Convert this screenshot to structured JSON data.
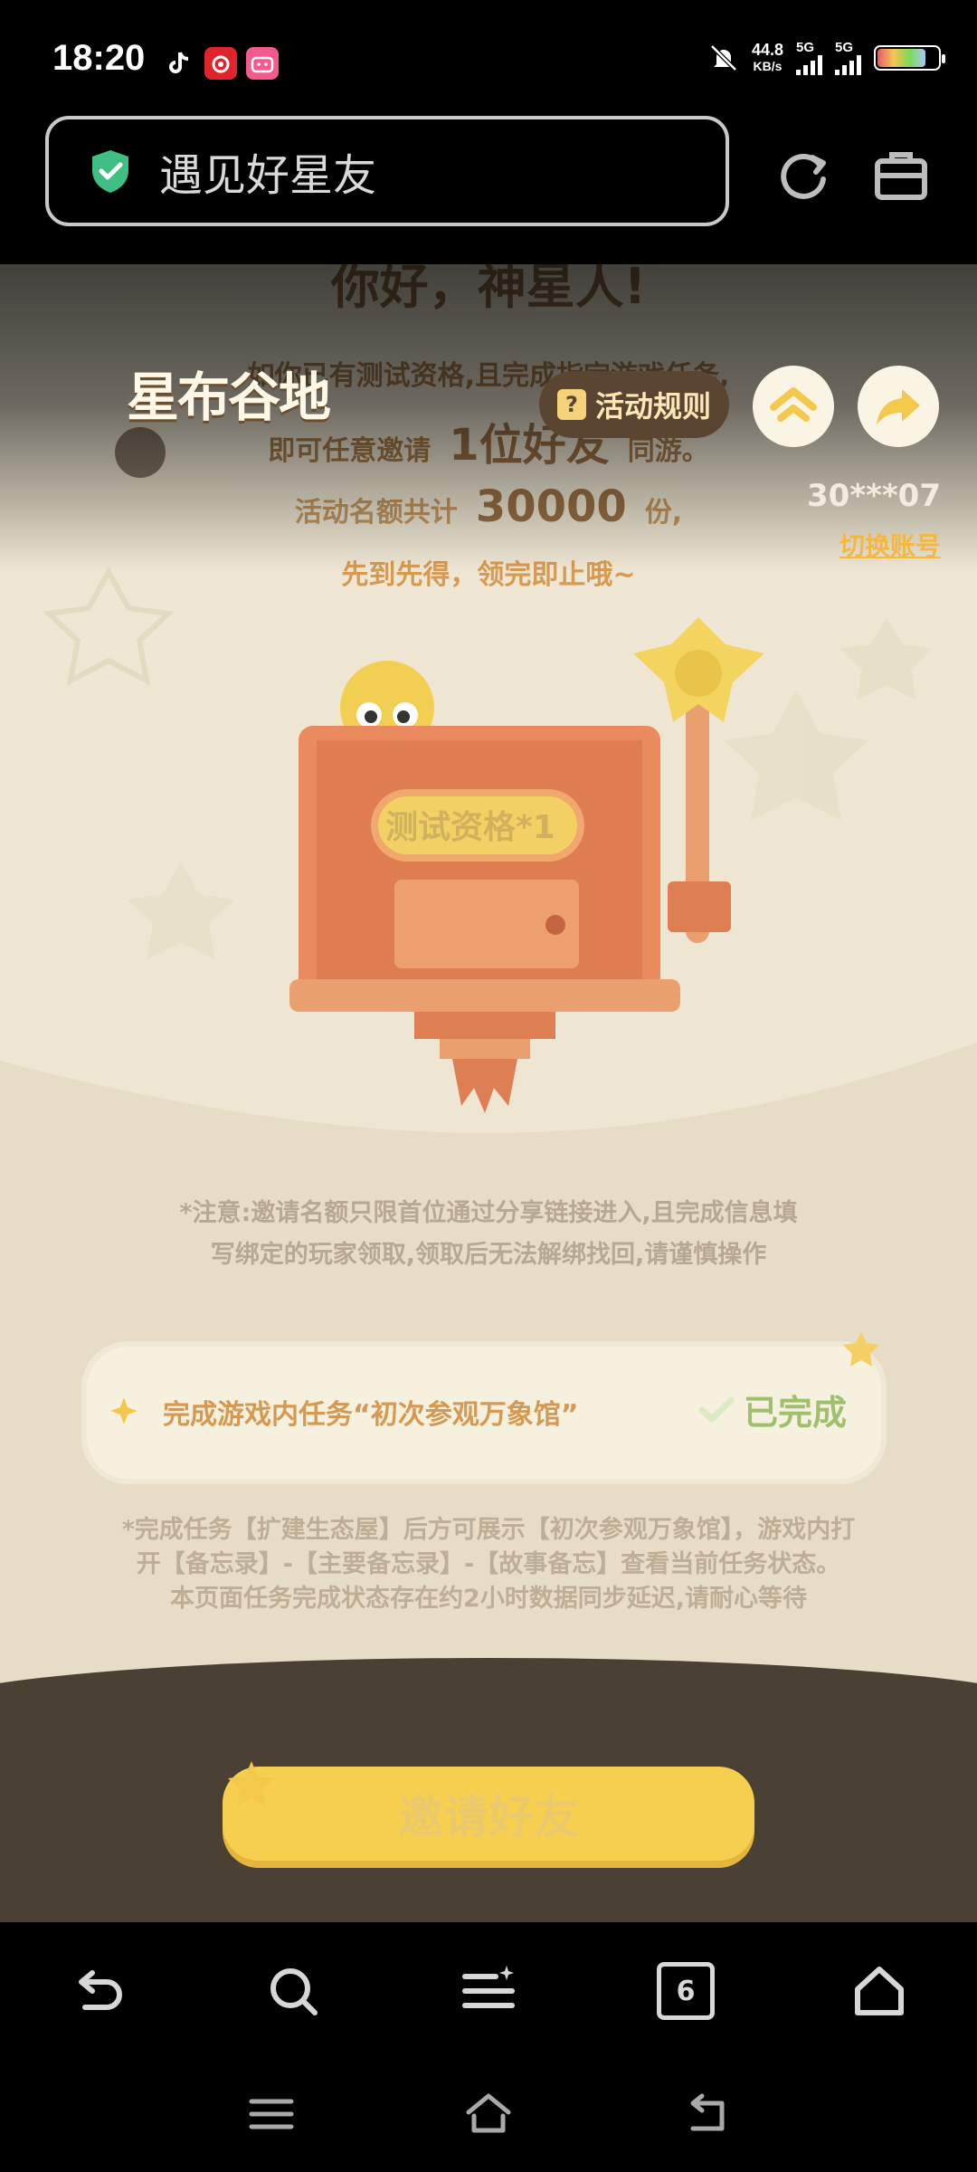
{
  "status_bar": {
    "time": "18:20",
    "net_speed_value": "44.8",
    "net_speed_unit": "KB/s",
    "sim1": "5G",
    "sim2": "5G",
    "battery_level": 0.8
  },
  "browser": {
    "url_title": "遇见好星友",
    "tab_count": "6"
  },
  "header": {
    "logo_text": "星布谷地",
    "rules_label": "活动规则",
    "account_id": "30***07",
    "switch_account": "切换账号"
  },
  "intro": {
    "line1": "你好，神星人!",
    "line2": "如你已有测试资格,且完成指定游戏任务,",
    "line3_prefix": "即可任意邀请",
    "line3_count": "1位好友",
    "line3_suffix": "同游。",
    "line4_prefix": "活动名额共计",
    "line4_count": "30000",
    "line4_suffix": "份,",
    "line5": "先到先得，领完即止哦~"
  },
  "machine": {
    "ticket_label": "测试资格*1"
  },
  "notice": {
    "line1": "*注意:邀请名额只限首位通过分享链接进入,且完成信息填",
    "line2": "写绑定的玩家领取,领取后无法解绑找回,请谨慎操作"
  },
  "task": {
    "text": "完成游戏内任务“初次参观万象馆”",
    "status": "已完成"
  },
  "footnote": {
    "line1": "*完成任务【扩建生态屋】后方可展示【初次参观万象馆】，游戏内打",
    "line2": "开【备忘录】-【主要备忘录】-【故事备忘】查看当前任务状态。",
    "line3": "本页面任务完成状态存在约2小时数据同步延迟,请耐心等待"
  },
  "invite_button": "邀请好友",
  "colors": {
    "page_bg": "#efe7d3",
    "accent_yellow": "#f7cf4f",
    "machine_orange": "#e98a5f",
    "done_green": "#9fbf6e"
  }
}
